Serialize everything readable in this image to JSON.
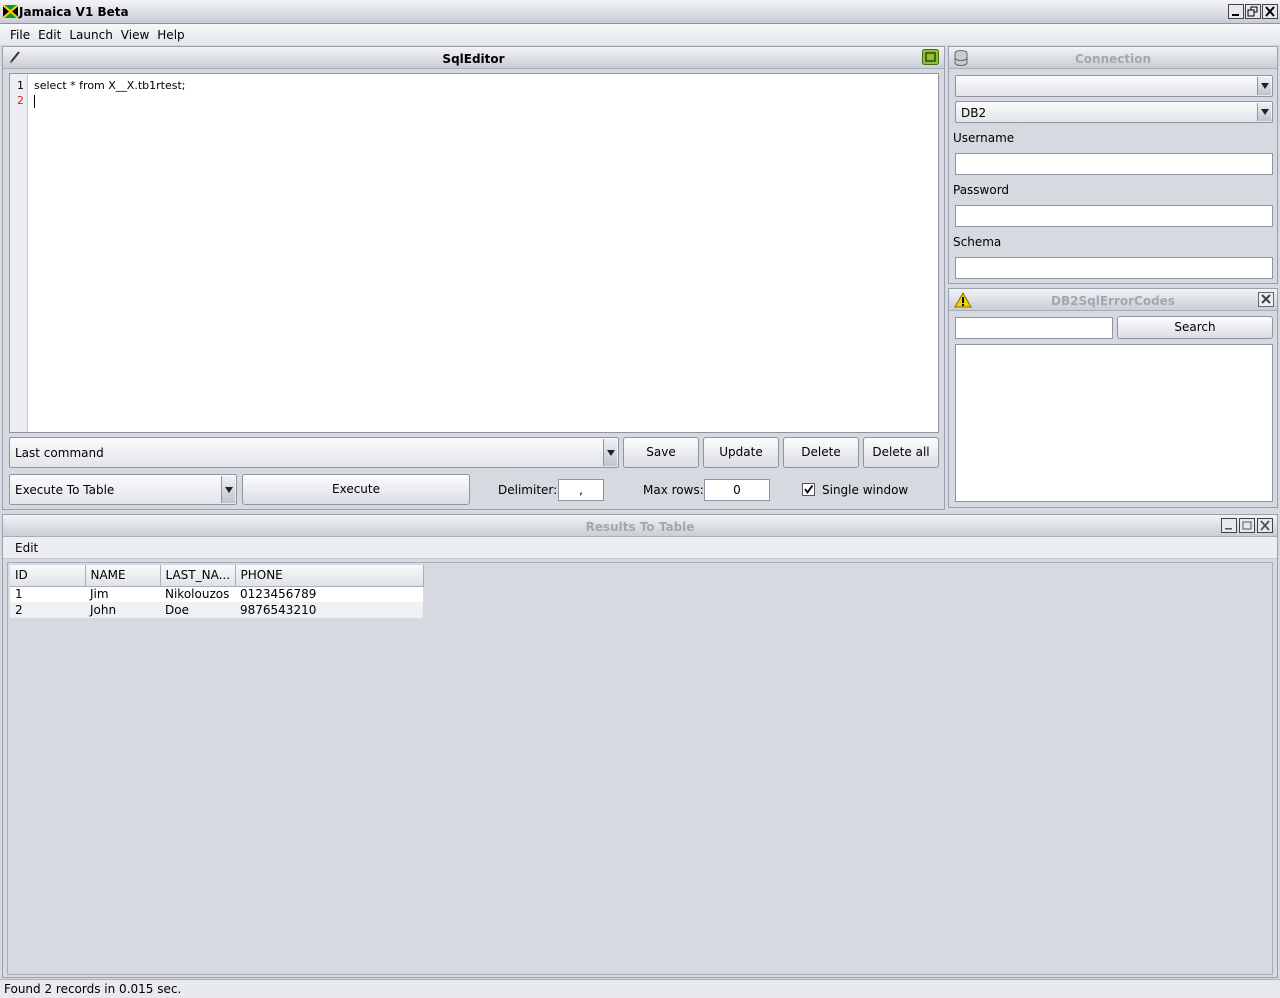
{
  "window": {
    "title": "Jamaica V1 Beta"
  },
  "menu": [
    "File",
    "Edit",
    "Launch",
    "View",
    "Help"
  ],
  "sql_editor": {
    "title": "SqlEditor",
    "line_numbers": [
      "1",
      "2"
    ],
    "code": [
      "select * from X__X.tb1rtest;",
      ""
    ],
    "last_command": "Last command",
    "buttons": {
      "save": "Save",
      "update": "Update",
      "delete": "Delete",
      "delete_all": "Delete all",
      "execute": "Execute"
    },
    "execute_mode": "Execute To Table",
    "delimiter_label": "Delimiter:",
    "delimiter_value": ",",
    "max_rows_label": "Max rows:",
    "max_rows_value": "0",
    "single_window_label": "Single window",
    "single_window_checked": true
  },
  "connection": {
    "title": "Connection",
    "connection_select": "",
    "db_type": "DB2",
    "username_label": "Username",
    "username_value": "",
    "password_label": "Password",
    "password_value": "",
    "schema_label": "Schema",
    "schema_value": ""
  },
  "error_codes": {
    "title": "DB2SqlErrorCodes",
    "search_value": "",
    "search_button": "Search"
  },
  "results": {
    "title": "Results To Table",
    "menu_edit": "Edit",
    "columns": [
      "ID",
      "NAME",
      "LAST_NA...",
      "PHONE"
    ],
    "rows": [
      [
        "1",
        "Jim",
        "Nikolouzos",
        "0123456789"
      ],
      [
        "2",
        "John",
        "Doe",
        "9876543210"
      ]
    ]
  },
  "status": "Found 2 records in 0.015 sec."
}
